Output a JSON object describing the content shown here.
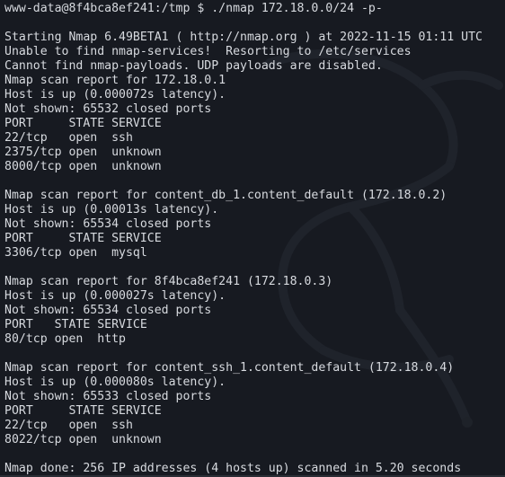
{
  "terminal": {
    "lines": [
      "www-data@8f4bca8ef241:/tmp $ ./nmap 172.18.0.0/24 -p-",
      "",
      "Starting Nmap 6.49BETA1 ( http://nmap.org ) at 2022-11-15 01:11 UTC",
      "Unable to find nmap-services!  Resorting to /etc/services",
      "Cannot find nmap-payloads. UDP payloads are disabled.",
      "Nmap scan report for 172.18.0.1",
      "Host is up (0.000072s latency).",
      "Not shown: 65532 closed ports",
      "PORT     STATE SERVICE",
      "22/tcp   open  ssh",
      "2375/tcp open  unknown",
      "8000/tcp open  unknown",
      "",
      "Nmap scan report for content_db_1.content_default (172.18.0.2)",
      "Host is up (0.00013s latency).",
      "Not shown: 65534 closed ports",
      "PORT     STATE SERVICE",
      "3306/tcp open  mysql",
      "",
      "Nmap scan report for 8f4bca8ef241 (172.18.0.3)",
      "Host is up (0.000027s latency).",
      "Not shown: 65534 closed ports",
      "PORT   STATE SERVICE",
      "80/tcp open  http",
      "",
      "Nmap scan report for content_ssh_1.content_default (172.18.0.4)",
      "Host is up (0.000080s latency).",
      "Not shown: 65533 closed ports",
      "PORT     STATE SERVICE",
      "22/tcp   open  ssh",
      "8022/tcp open  unknown",
      "",
      "Nmap done: 256 IP addresses (4 hosts up) scanned in 5.20 seconds"
    ]
  },
  "colors": {
    "background": "#171a21",
    "text": "#d7dadf",
    "watermark": "#20242c"
  },
  "icons": {
    "watermark": "kali-dragon-watermark-icon"
  }
}
